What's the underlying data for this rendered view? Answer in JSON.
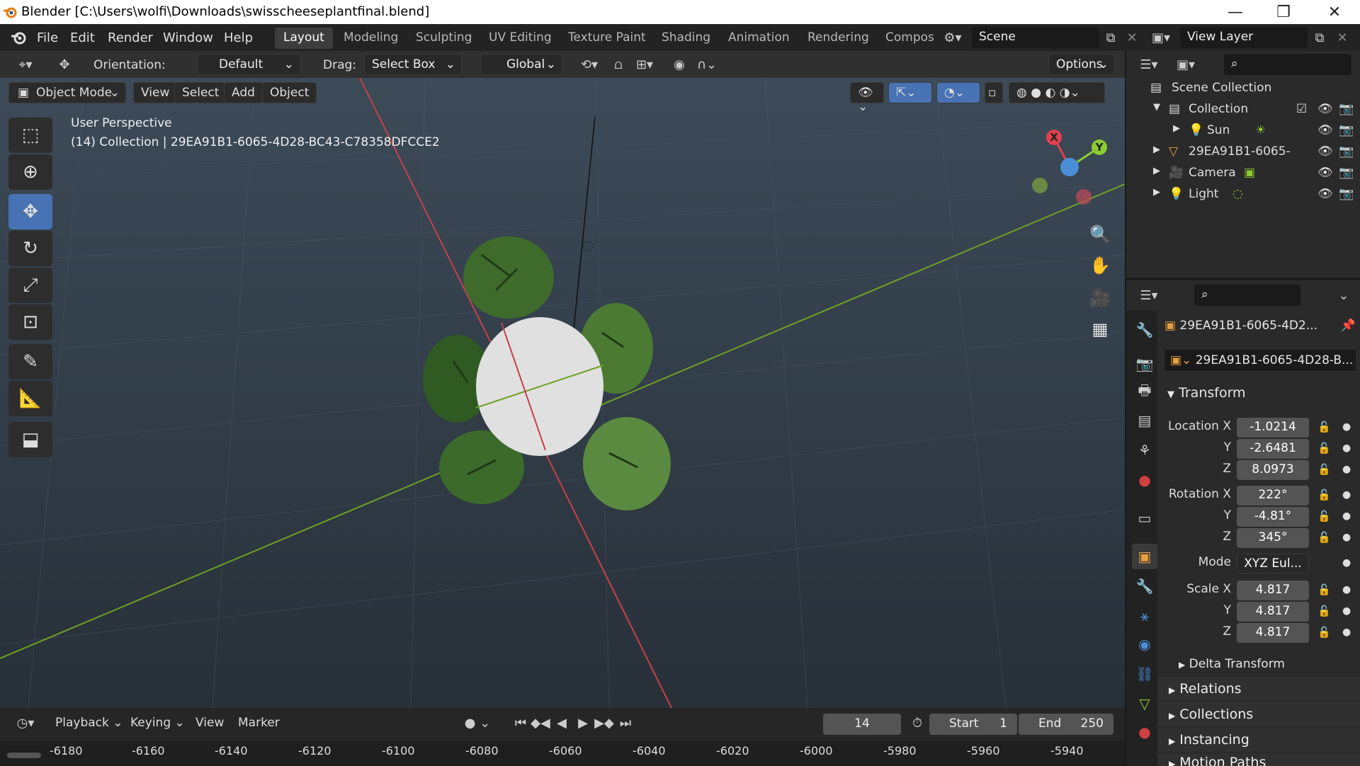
{
  "window": {
    "title": "Blender [C:\\Users\\wolfi\\Downloads\\swisscheeseplantfinal.blend]",
    "min": "—",
    "max": "❐",
    "close": "✕"
  },
  "menubar": {
    "items": [
      "File",
      "Edit",
      "Render",
      "Window",
      "Help"
    ],
    "workspaces": [
      "Layout",
      "Modeling",
      "Sculpting",
      "UV Editing",
      "Texture Paint",
      "Shading",
      "Animation",
      "Rendering",
      "Compos"
    ],
    "active_workspace": "Layout",
    "scene": "Scene",
    "view_layer": "View Layer"
  },
  "toolheader": {
    "orientation_label": "Orientation:",
    "orientation_value": "Default",
    "drag_label": "Drag:",
    "drag_value": "Select Box",
    "transform_value": "Global",
    "options": "Options"
  },
  "viewport": {
    "mode": "Object Mode",
    "menus": [
      "View",
      "Select",
      "Add",
      "Object"
    ],
    "overlay_line1": "User Perspective",
    "overlay_line2": "(14) Collection | 29EA91B1-6065-4D28-BC43-C78358DFCCE2",
    "axis_x": "X",
    "axis_y": "Y"
  },
  "outliner": {
    "root": "Scene Collection",
    "collection": "Collection",
    "items": [
      "Sun",
      "29EA91B1-6065-",
      "Camera",
      "Light"
    ]
  },
  "properties": {
    "object_name": "29EA91B1-6065-4D2...",
    "data_name": "29EA91B1-6065-4D28-B...",
    "transform_header": "Transform",
    "location_label": "Location X",
    "rotation_label": "Rotation X",
    "scale_label": "Scale X",
    "y_label": "Y",
    "z_label": "Z",
    "mode_label": "Mode",
    "location": [
      "-1.0214",
      "-2.6481",
      "8.0973"
    ],
    "rotation": [
      "222°",
      "-4.81°",
      "345°"
    ],
    "mode": "XYZ Eul...",
    "scale": [
      "4.817",
      "4.817",
      "4.817"
    ],
    "delta": "Delta Transform",
    "sections": [
      "Relations",
      "Collections",
      "Instancing",
      "Motion Paths"
    ]
  },
  "timeline": {
    "menus": [
      "Playback",
      "Keying",
      "View",
      "Marker"
    ],
    "frame": "14",
    "start_label": "Start",
    "start": "1",
    "end_label": "End",
    "end": "250",
    "ruler": [
      "-6180",
      "-6160",
      "-6140",
      "-6120",
      "-6100",
      "-6080",
      "-6060",
      "-6040",
      "-6020",
      "-6000",
      "-5980",
      "-5960",
      "-5940"
    ]
  },
  "colors": {
    "accent": "#4772b3",
    "x_axis": "#e04050",
    "y_axis": "#8ccc30",
    "z_axis": "#4a8ed8"
  }
}
